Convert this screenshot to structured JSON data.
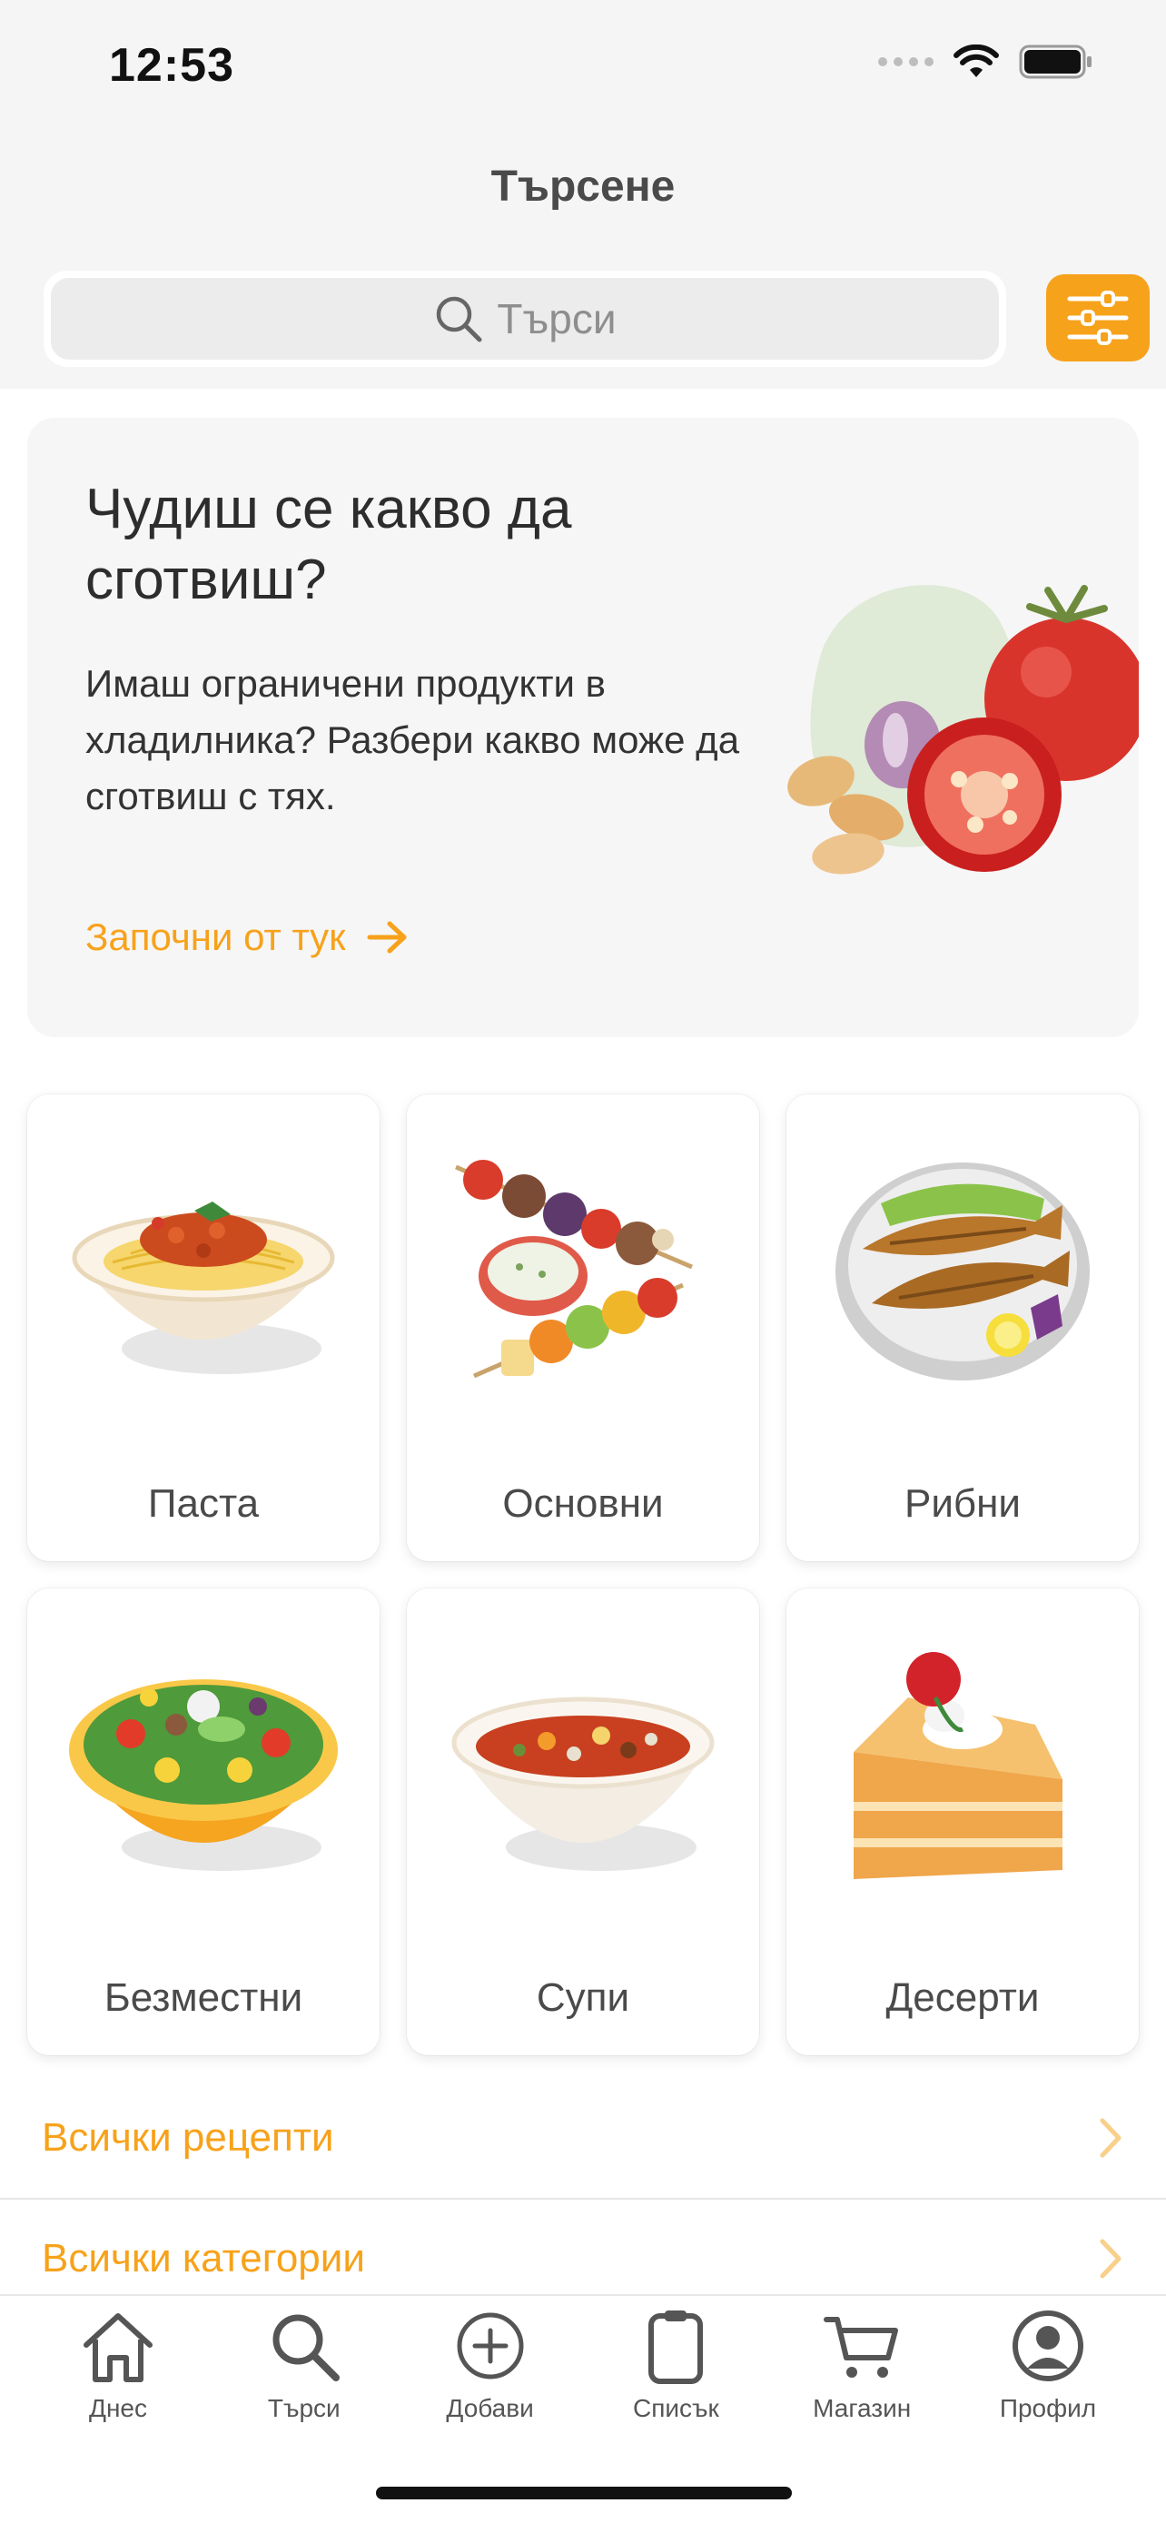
{
  "status_bar": {
    "time": "12:53"
  },
  "header": {
    "title": "Търсене"
  },
  "search": {
    "placeholder": "Търси"
  },
  "promo": {
    "title": "Чудиш се какво да сготвиш?",
    "description": "Имаш ограничени продукти в хладилника? Разбери какво може да сготвиш с тях.",
    "link_label": "Започни от тук"
  },
  "categories": [
    {
      "label": "Паста",
      "icon": "pasta-bowl-icon"
    },
    {
      "label": "Основни",
      "icon": "skewers-icon"
    },
    {
      "label": "Рибни",
      "icon": "fish-plate-icon"
    },
    {
      "label": "Безместни",
      "icon": "salad-bowl-icon"
    },
    {
      "label": "Супи",
      "icon": "soup-bowl-icon"
    },
    {
      "label": "Десерти",
      "icon": "cake-slice-icon"
    }
  ],
  "links": [
    {
      "label": "Всички рецепти"
    },
    {
      "label": "Всички категории"
    }
  ],
  "tabbar": {
    "items": [
      {
        "label": "Днес",
        "icon": "home-icon"
      },
      {
        "label": "Търси",
        "icon": "search-icon"
      },
      {
        "label": "Добави",
        "icon": "add-circle-icon"
      },
      {
        "label": "Списък",
        "icon": "clipboard-icon"
      },
      {
        "label": "Магазин",
        "icon": "cart-icon"
      },
      {
        "label": "Профил",
        "icon": "profile-icon"
      }
    ]
  },
  "colors": {
    "accent": "#f7a21b",
    "background": "#f5f5f5",
    "text": "#333333"
  }
}
